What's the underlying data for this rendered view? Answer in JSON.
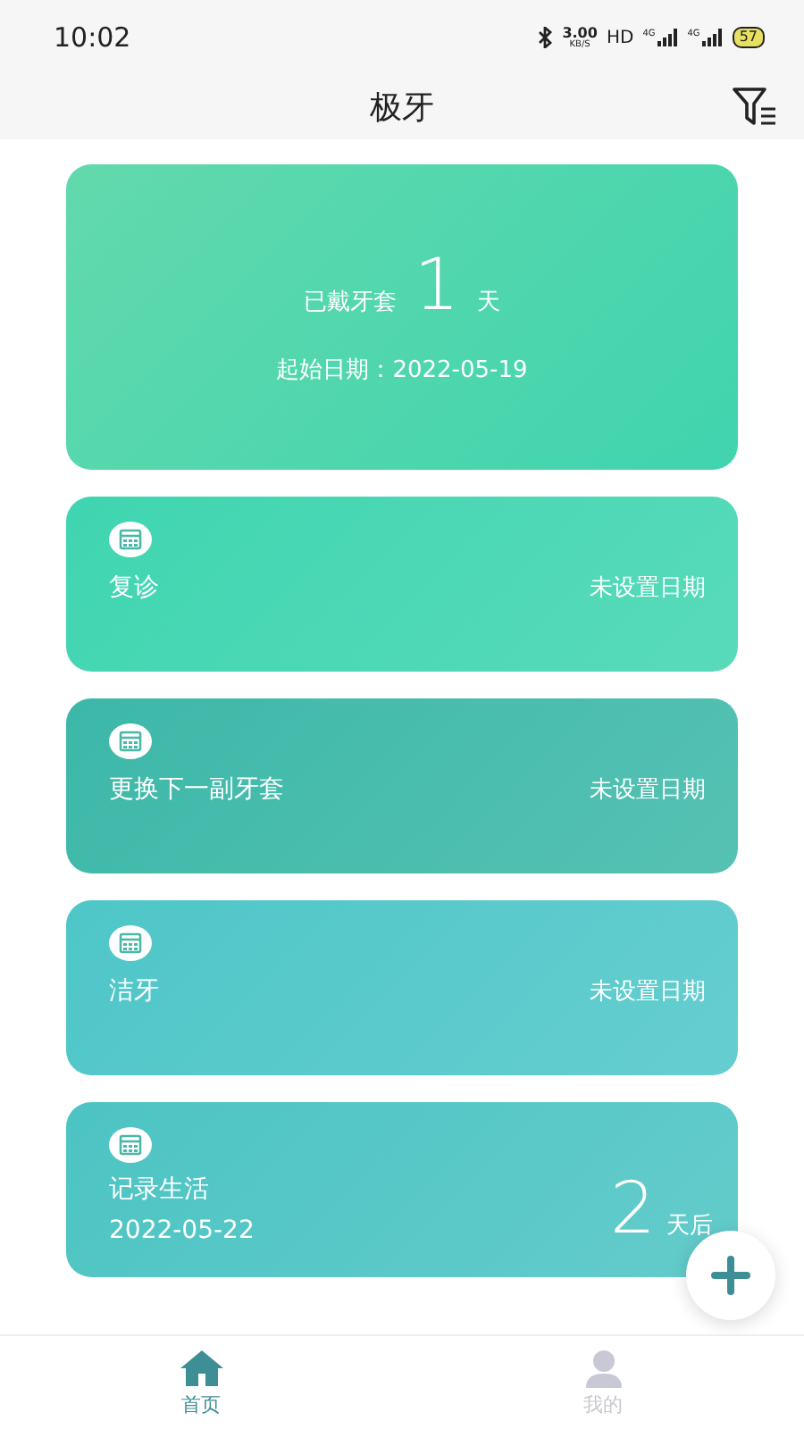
{
  "status_bar": {
    "time": "10:02",
    "speed": "3.00",
    "speed_unit": "KB/S",
    "hd": "HD",
    "network_1": "4G",
    "network_2": "4G",
    "battery": "57"
  },
  "header": {
    "title": "极牙"
  },
  "summary": {
    "prefix": "已戴牙套",
    "days": "1",
    "suffix": "天",
    "start_date": "起始日期：2022-05-19"
  },
  "cards": [
    {
      "kind": "event",
      "title": "复诊",
      "status": "未设置日期",
      "color": "#3fd5b0"
    },
    {
      "kind": "event",
      "title": "更换下一副牙套",
      "status": "未设置日期",
      "color": "#3cb8a8"
    },
    {
      "kind": "event",
      "title": "洁牙",
      "status": "未设置日期",
      "color": "#4ec6c8"
    },
    {
      "kind": "countdown",
      "title": "记录生活",
      "date": "2022-05-22",
      "days": "2",
      "suffix": "天后",
      "color": "#4cc4c3"
    }
  ],
  "tabs": [
    {
      "label": "首页",
      "selected": true
    },
    {
      "label": "我的",
      "selected": false
    }
  ]
}
